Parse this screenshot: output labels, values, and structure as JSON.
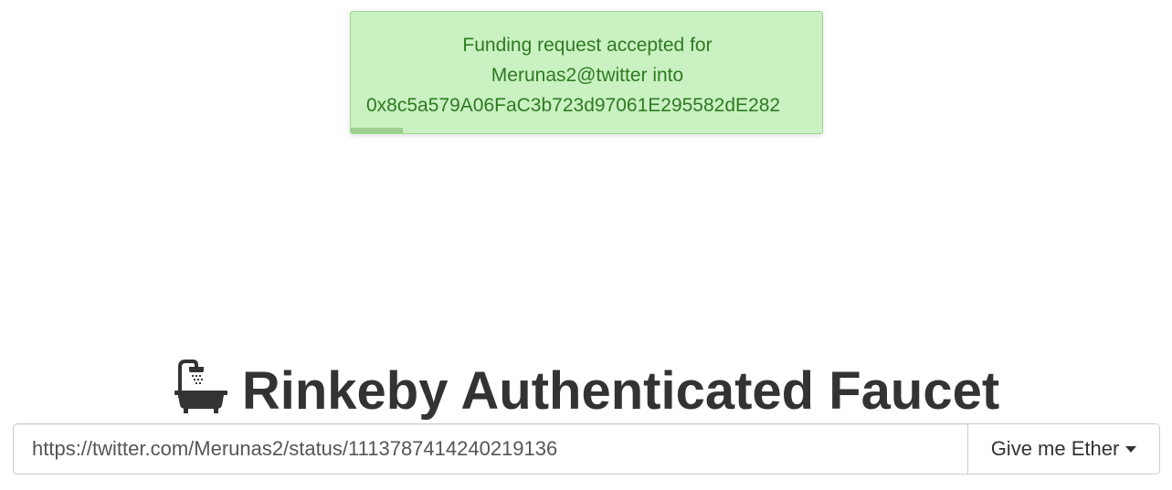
{
  "notification": {
    "line1": "Funding request accepted for",
    "line2": "Merunas2@twitter into",
    "line3": "0x8c5a579A06FaC3b723d97061E295582dE282",
    "progress_percent": 11,
    "background_color": "#c9f1c1",
    "text_color": "#2f7a22"
  },
  "header": {
    "icon": "bath-icon",
    "title": "Rinkeby Authenticated Faucet"
  },
  "form": {
    "url_value": "https://twitter.com/Merunas2/status/1113787414240219136",
    "button_label": "Give me Ether",
    "button_icon": "caret-down-icon"
  }
}
